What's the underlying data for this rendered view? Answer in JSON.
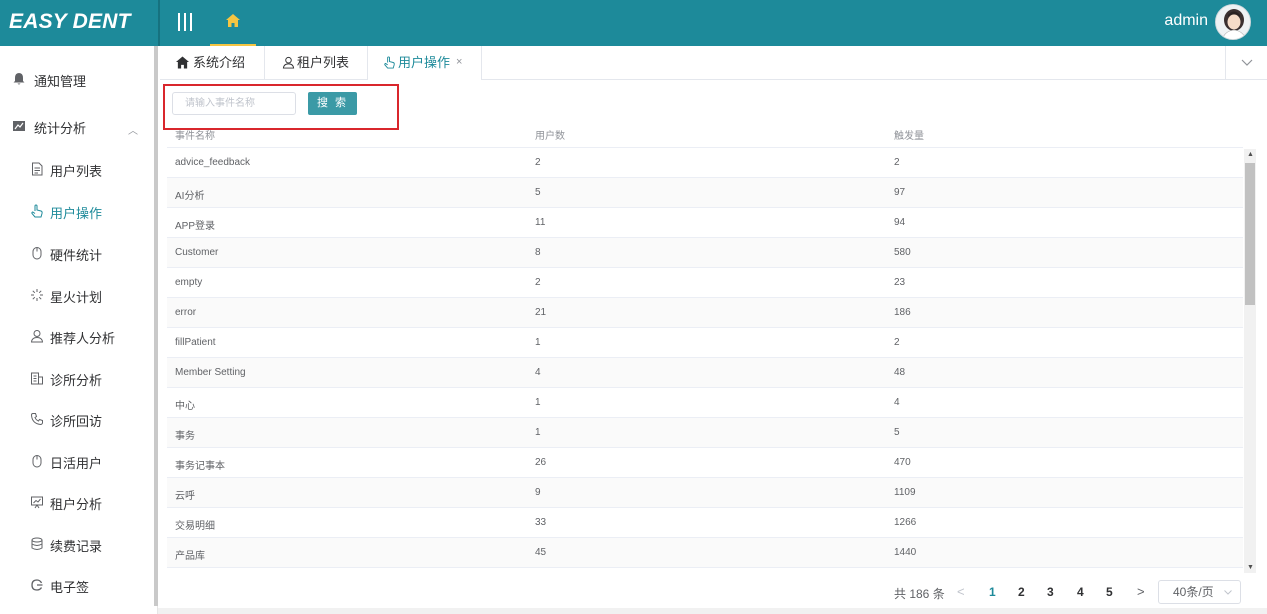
{
  "header": {
    "logo": "EASY DENT",
    "user_name": "admin"
  },
  "sidebar": {
    "items": [
      {
        "label": "通知管理",
        "icon": "bell-icon"
      },
      {
        "label": "统计分析",
        "icon": "line-chart-icon"
      },
      {
        "label": "用户列表",
        "icon": "document-icon"
      },
      {
        "label": "用户操作",
        "icon": "pointer-hand-icon"
      },
      {
        "label": "硬件统计",
        "icon": "mouse-icon"
      },
      {
        "label": "星火计划",
        "icon": "sparkle-icon"
      },
      {
        "label": "推荐人分析",
        "icon": "user-icon"
      },
      {
        "label": "诊所分析",
        "icon": "building-icon"
      },
      {
        "label": "诊所回访",
        "icon": "phone-icon"
      },
      {
        "label": "日活用户",
        "icon": "mouse-icon"
      },
      {
        "label": "租户分析",
        "icon": "presentation-icon"
      },
      {
        "label": "续费记录",
        "icon": "database-icon"
      },
      {
        "label": "电子签",
        "icon": "signature-icon"
      }
    ]
  },
  "tabs": [
    {
      "label": "系统介绍",
      "icon": "home-icon"
    },
    {
      "label": "租户列表",
      "icon": "user-icon"
    },
    {
      "label": "用户操作",
      "icon": "pointer-hand-icon",
      "close": "×"
    }
  ],
  "search": {
    "placeholder": "请输入事件名称",
    "button": "搜 索"
  },
  "table": {
    "columns": [
      "事件名称",
      "用户数",
      "触发量"
    ],
    "rows": [
      [
        "advice_feedback",
        "2",
        "2"
      ],
      [
        "AI分析",
        "5",
        "97"
      ],
      [
        "APP登录",
        "11",
        "94"
      ],
      [
        "Customer",
        "8",
        "580"
      ],
      [
        "empty",
        "2",
        "23"
      ],
      [
        "error",
        "21",
        "186"
      ],
      [
        "fillPatient",
        "1",
        "2"
      ],
      [
        "Member Setting",
        "4",
        "48"
      ],
      [
        "中心",
        "1",
        "4"
      ],
      [
        "事务",
        "1",
        "5"
      ],
      [
        "事务记事本",
        "26",
        "470"
      ],
      [
        "云呼",
        "9",
        "1109"
      ],
      [
        "交易明细",
        "33",
        "1266"
      ],
      [
        "产品库",
        "45",
        "1440"
      ]
    ]
  },
  "pagination": {
    "total": "共 186 条",
    "prev": "<",
    "next": ">",
    "pages": [
      "1",
      "2",
      "3",
      "4",
      "5"
    ],
    "current": "1",
    "page_size": "40条/页"
  },
  "colors": {
    "brand": "#1d8a9a",
    "highlight_box": "#d9262c"
  }
}
